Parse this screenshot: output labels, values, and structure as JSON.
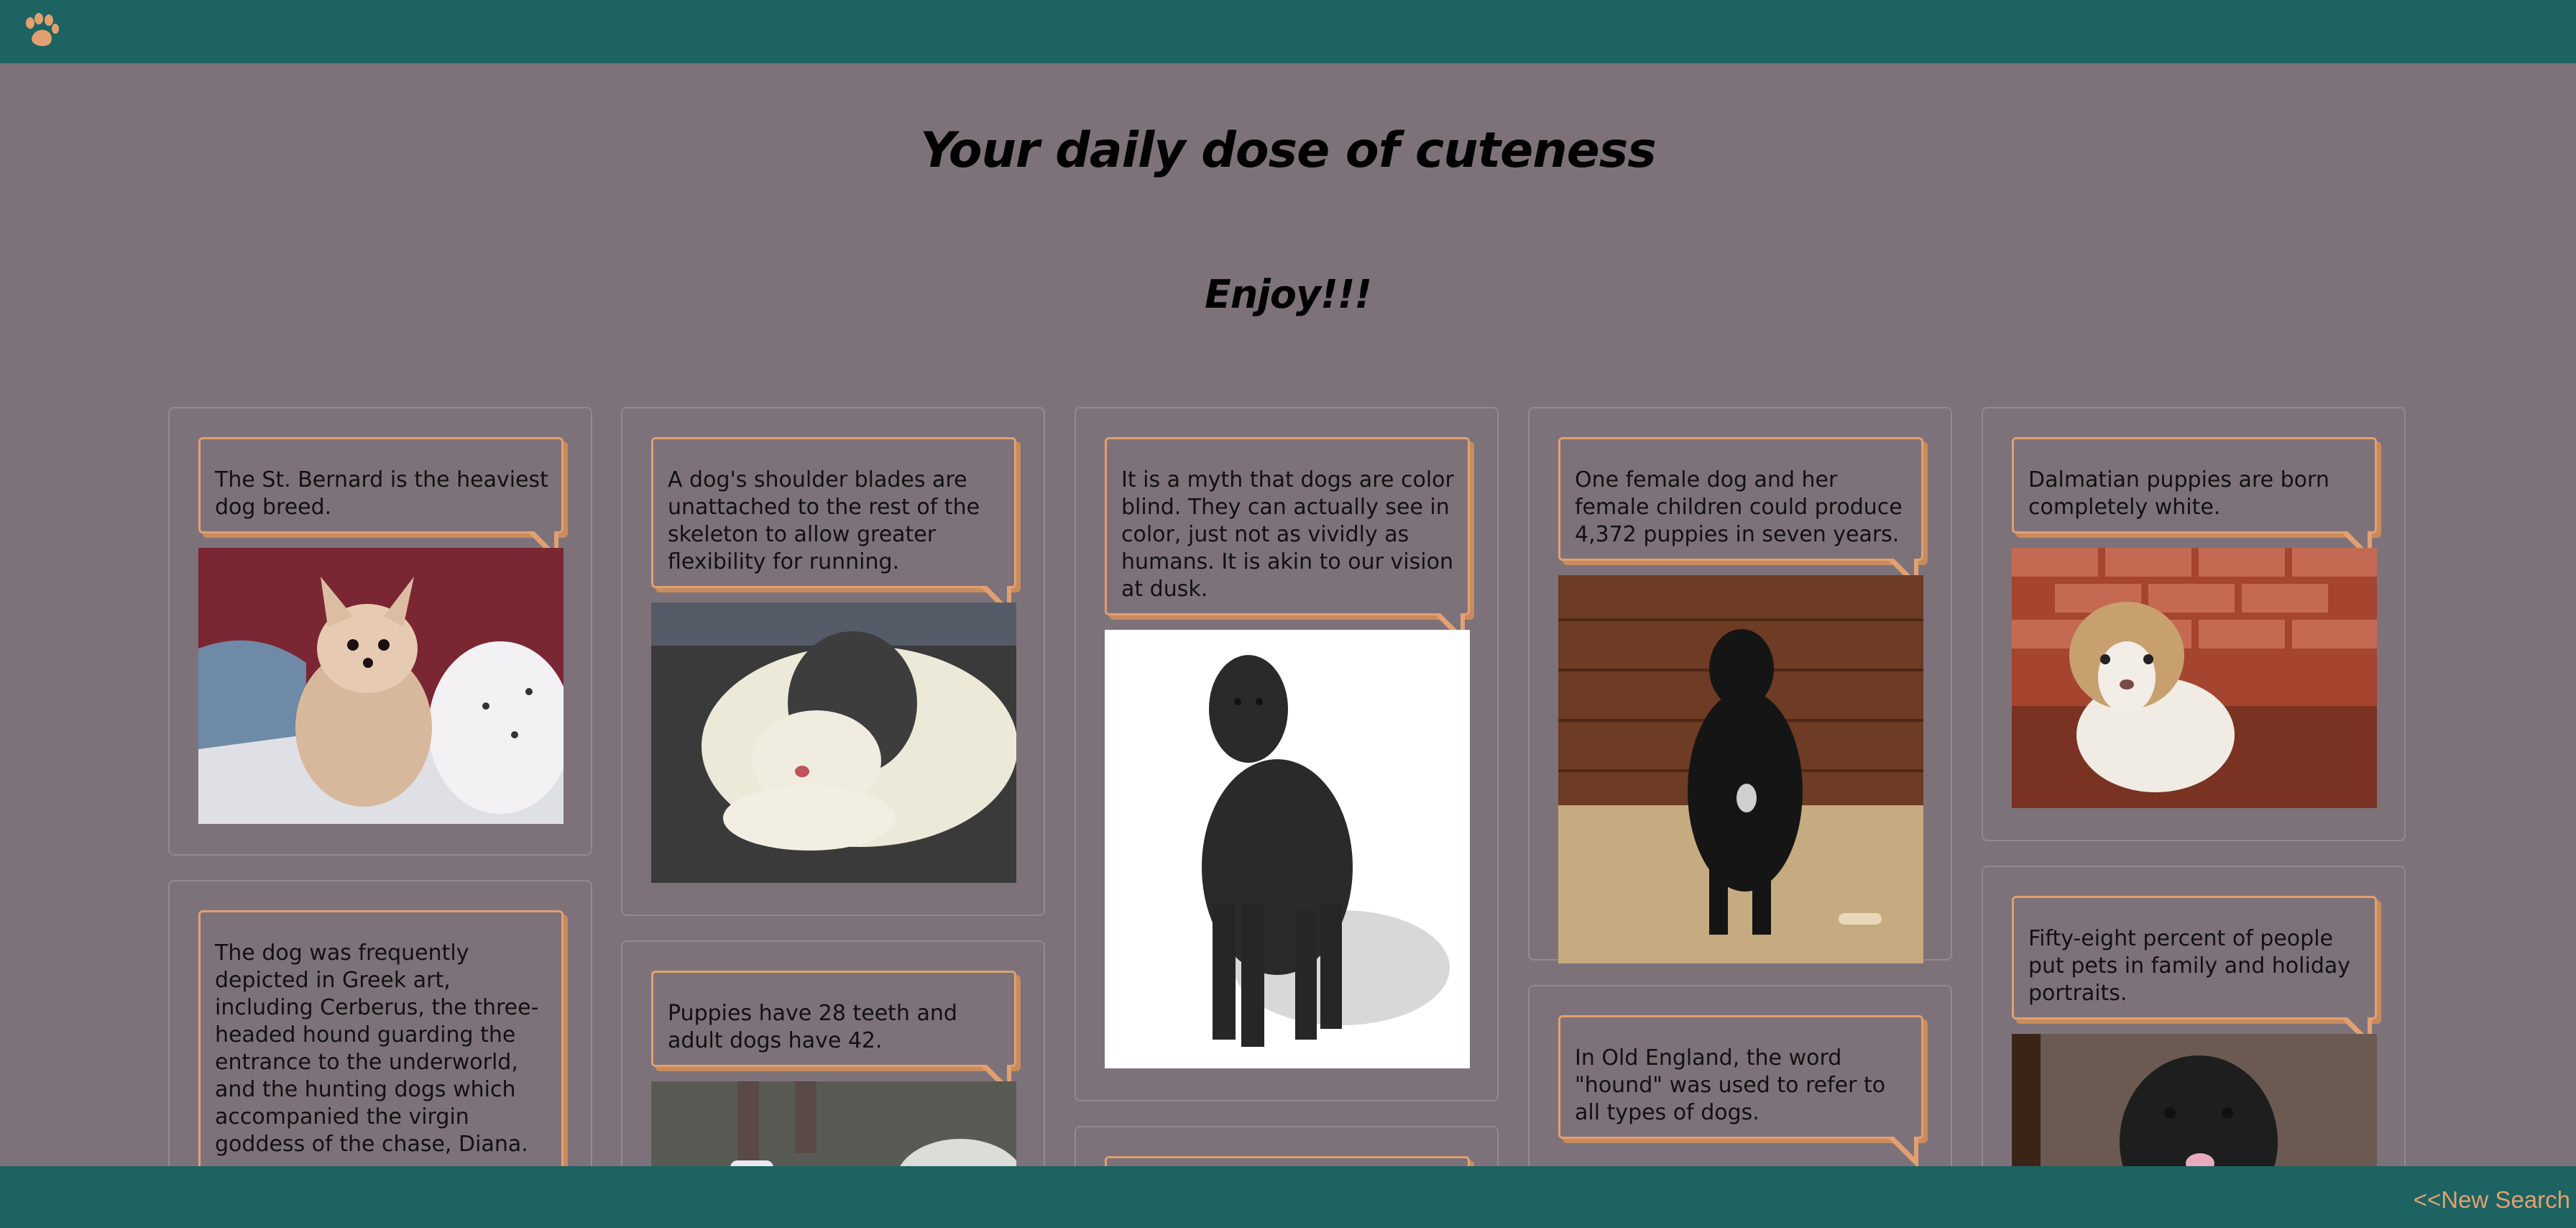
{
  "header": {
    "logo_icon": "paw-icon"
  },
  "main": {
    "title": "Your daily dose of cuteness",
    "subtitle": "Enjoy!!!"
  },
  "cards": [
    {
      "fact": "The St. Bernard is the heaviest dog breed.",
      "image": "pomeranian-on-bed"
    },
    {
      "fact": "A dog's shoulder blades are unattached to the rest of the skeleton to allow greater flexibility for running.",
      "image": "sheepdog-lying"
    },
    {
      "fact": "It is a myth that dogs are color blind. They can actually see in color, just not as vividly as humans. It is akin to our vision at dusk.",
      "image": "black-curly-dog"
    },
    {
      "fact": "One female dog and her female children could produce 4,372 puppies in seven years.",
      "image": "black-puppy-sitting"
    },
    {
      "fact": "Dalmatian puppies are born completely white.",
      "image": "tan-white-puppy"
    },
    {
      "fact": "The dog was frequently depicted in Greek art, including Cerberus, the three-headed hound guarding the entrance to the underworld, and the hunting dogs which accompanied the virgin goddess of the chase, Diana.",
      "image": ""
    },
    {
      "fact": "Puppies have 28 teeth and adult dogs have 42.",
      "image": "dog-walking"
    },
    {
      "fact": "",
      "image": ""
    },
    {
      "fact": "In Old England, the word \"hound\" was used to refer to all types of dogs.",
      "image": ""
    },
    {
      "fact": "Fifty-eight percent of people put pets in family and holiday portraits.",
      "image": "black-shaggy-dog"
    }
  ],
  "footer": {
    "new_search_label": "<<New Search"
  },
  "colors": {
    "bar": "#1c6362",
    "background": "#7e727a",
    "accent": "#e2a070"
  }
}
